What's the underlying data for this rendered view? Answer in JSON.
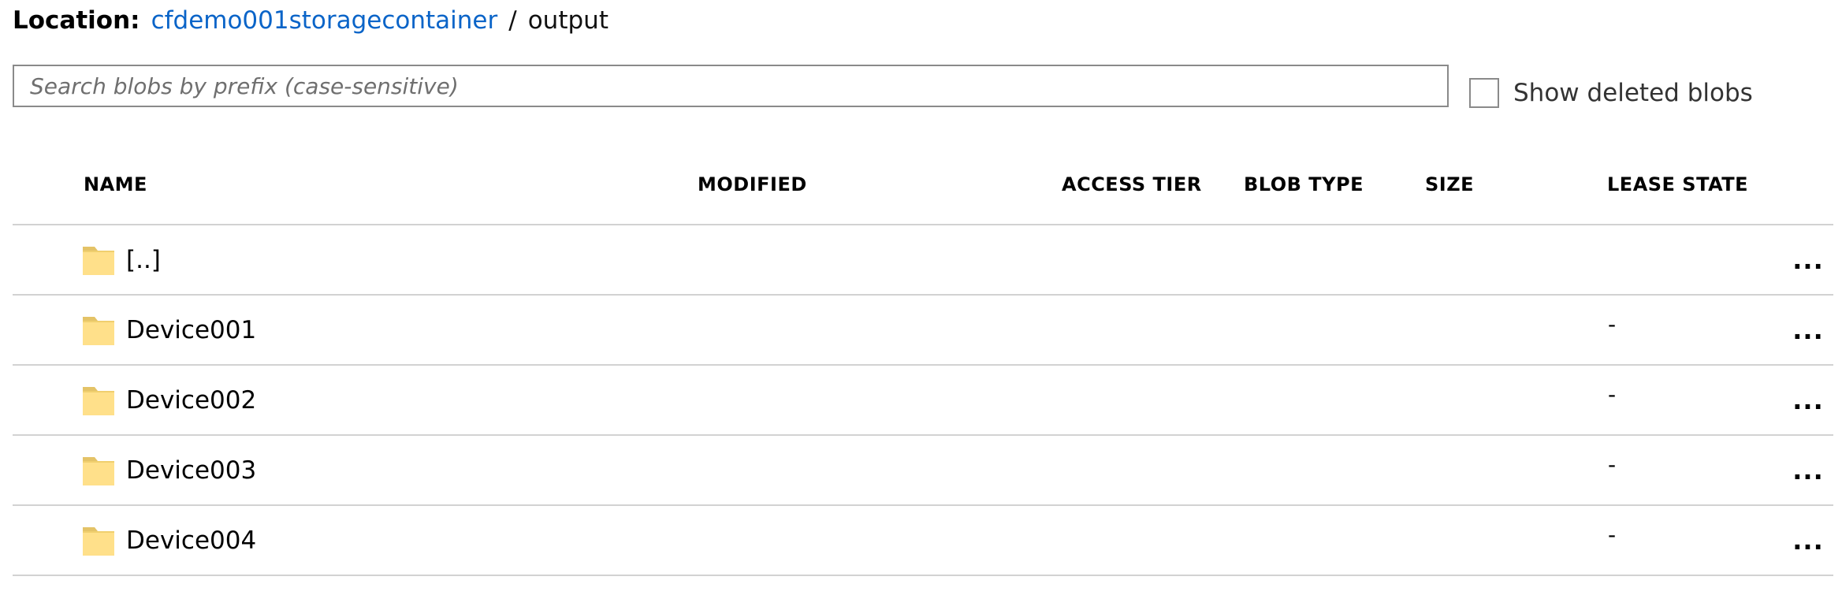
{
  "location": {
    "label": "Location:",
    "container": "cfdemo001storagecontainer",
    "separator": "/",
    "current": "output"
  },
  "search": {
    "placeholder": "Search blobs by prefix (case-sensitive)",
    "value": ""
  },
  "show_deleted": {
    "label": "Show deleted blobs",
    "checked": false
  },
  "table": {
    "columns": [
      "NAME",
      "MODIFIED",
      "ACCESS TIER",
      "BLOB TYPE",
      "SIZE",
      "LEASE STATE"
    ],
    "rows": [
      {
        "icon": "folder-icon",
        "name": "[..]",
        "lease_state": "",
        "menu": "..."
      },
      {
        "icon": "folder-icon",
        "name": "Device001",
        "lease_state": "-",
        "menu": "..."
      },
      {
        "icon": "folder-icon",
        "name": "Device002",
        "lease_state": "-",
        "menu": "..."
      },
      {
        "icon": "folder-icon",
        "name": "Device003",
        "lease_state": "-",
        "menu": "..."
      },
      {
        "icon": "folder-icon",
        "name": "Device004",
        "lease_state": "-",
        "menu": "..."
      }
    ]
  },
  "colors": {
    "link": "#0a64c8",
    "folder_fill": "#ffe08a",
    "folder_tab": "#e4c367",
    "divider": "#d2d2d2"
  }
}
